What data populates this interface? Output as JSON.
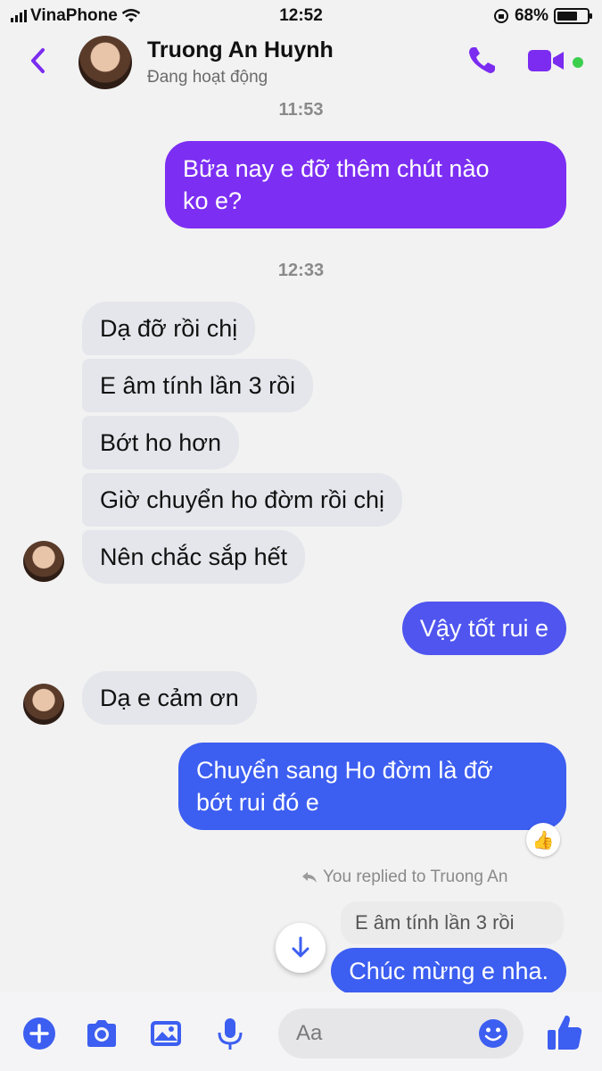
{
  "status_bar": {
    "carrier": "VinaPhone",
    "time": "12:52",
    "battery": "68%",
    "battery_level": 0.68
  },
  "header": {
    "contact_name": "Truong An Huynh",
    "status": "Đang hoạt động"
  },
  "timestamps": [
    "11:53",
    "12:33"
  ],
  "messages": [
    {
      "from": "me",
      "text_lines": [
        "Bữa nay e đỡ thêm chút nào",
        "ko e?"
      ]
    },
    {
      "from": "them",
      "text": "Dạ đỡ rồi chị"
    },
    {
      "from": "them",
      "text": "E âm tính lần 3 rồi"
    },
    {
      "from": "them",
      "text": "Bớt ho hơn"
    },
    {
      "from": "them",
      "text": "Giờ chuyển ho đờm rồi chị"
    },
    {
      "from": "them",
      "text": "Nên chắc sắp hết"
    },
    {
      "from": "me",
      "text": "Vậy tốt rui e"
    },
    {
      "from": "them",
      "text": "Dạ e cảm ơn"
    },
    {
      "from": "me",
      "text_lines": [
        "Chuyển sang Ho đờm là đỡ",
        "bớt rui đó e"
      ],
      "reaction": "👍"
    },
    {
      "from": "me",
      "text": "Chúc mừng e nha."
    }
  ],
  "reply": {
    "note": "You replied to Truong An",
    "quoted": "E âm tính lần 3 rồi"
  },
  "composer": {
    "placeholder": "Aa"
  },
  "colors": {
    "accent": "#7b2cf0",
    "out_purple": "#7c2ef3",
    "out_blue": "#3c5ef1",
    "in_bubble": "#e4e6eb",
    "active": "#3ccf4e"
  }
}
